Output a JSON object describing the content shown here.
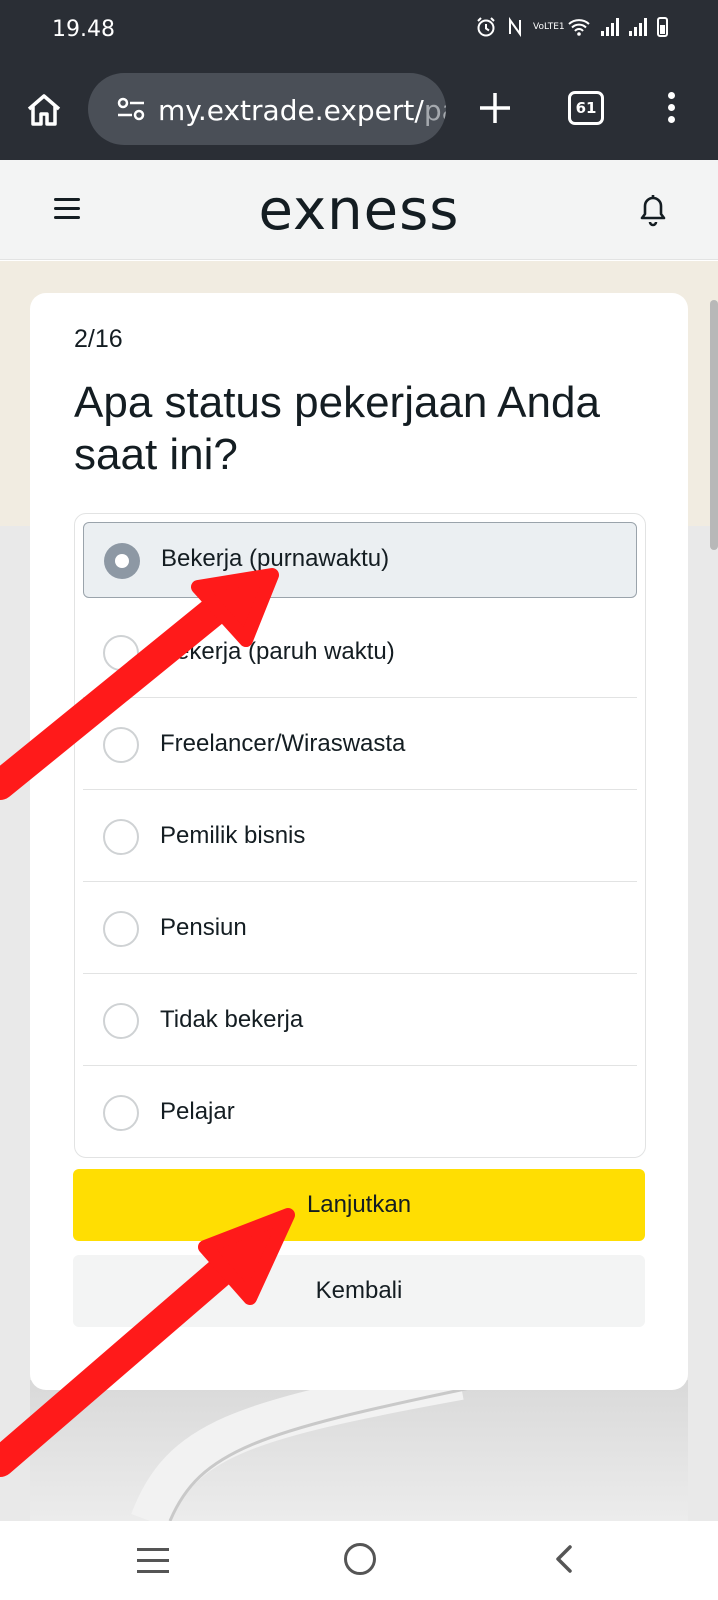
{
  "status_bar": {
    "time": "19.48",
    "icons": [
      "alarm-icon",
      "nfc-icon",
      "volte-icon",
      "wifi-icon",
      "signal-icon",
      "signal-icon",
      "battery-icon"
    ],
    "volte_label": "VoLTE1"
  },
  "browser": {
    "url_main": "my.extrade.expert/",
    "url_dim": "pa",
    "tab_count": "61",
    "icons": [
      "home-icon",
      "site-settings-icon",
      "plus-icon",
      "tabs-icon",
      "more-vert-icon"
    ]
  },
  "app_header": {
    "logo": "exness",
    "icons": [
      "hamburger-icon",
      "bell-icon"
    ]
  },
  "questionnaire": {
    "step": "2/16",
    "question": "Apa status pekerjaan Anda saat ini?",
    "selected_index": 0,
    "options": [
      {
        "label": "Bekerja (purnawaktu)"
      },
      {
        "label": "Bekerja (paruh waktu)"
      },
      {
        "label": "Freelancer/Wiraswasta"
      },
      {
        "label": "Pemilik bisnis"
      },
      {
        "label": "Pensiun"
      },
      {
        "label": "Tidak bekerja"
      },
      {
        "label": "Pelajar"
      }
    ],
    "continue_label": "Lanjutkan",
    "back_label": "Kembali"
  },
  "colors": {
    "primary_button": "#ffde02",
    "annotation_arrow": "#ff1a1a",
    "browser_chrome": "#2a2e35"
  },
  "nav_bar": {
    "icons": [
      "recent-apps-icon",
      "home-circle-icon",
      "back-icon"
    ]
  }
}
